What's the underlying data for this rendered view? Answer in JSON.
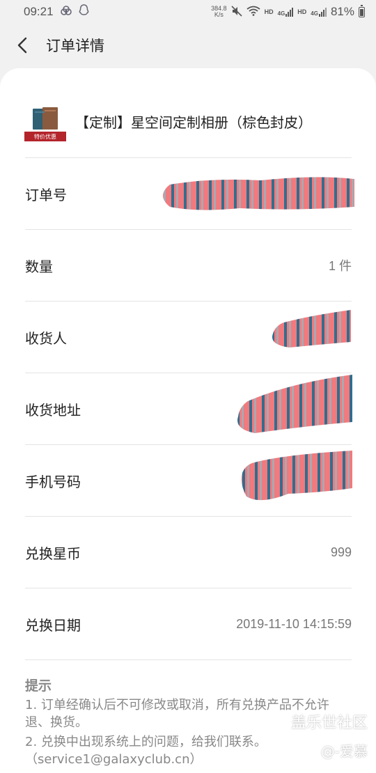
{
  "status_bar": {
    "time": "09:21",
    "net_speed_value": "384.8",
    "net_speed_unit": "K/s",
    "hd1": "HD",
    "lte1": "4G",
    "hd2": "HD",
    "lte2": "4G",
    "battery_percent": "81%",
    "battery_level": 0.81
  },
  "header": {
    "title": "订单详情"
  },
  "product": {
    "name": "【定制】星空间定制相册（棕色封皮）",
    "badge": "特价优惠"
  },
  "rows": [
    {
      "label": "订单号",
      "value": ""
    },
    {
      "label": "数量",
      "value": "1 件"
    },
    {
      "label": "收货人",
      "value": ""
    },
    {
      "label": "收货地址",
      "value": ""
    },
    {
      "label": "手机号码",
      "value": ""
    },
    {
      "label": "兑换星币",
      "value": "999"
    },
    {
      "label": "兑换日期",
      "value": "2019-11-10 14:15:59"
    }
  ],
  "tips": {
    "title": "提示",
    "line1": "1. 订单经确认后不可修改或取消，所有兑换产品不允许退、换货。",
    "line2": "2. 兑换中出现系统上的问题，给我们联系。",
    "line3": "（service1@galaxyclub.cn）"
  },
  "watermark": {
    "line1": "盖乐世社区",
    "line2": "@-爱慕"
  },
  "colors": {
    "redaction_pink": "#f07a7e",
    "redaction_teal": "#2f6f8f",
    "redaction_gray": "#a9a9b2"
  }
}
